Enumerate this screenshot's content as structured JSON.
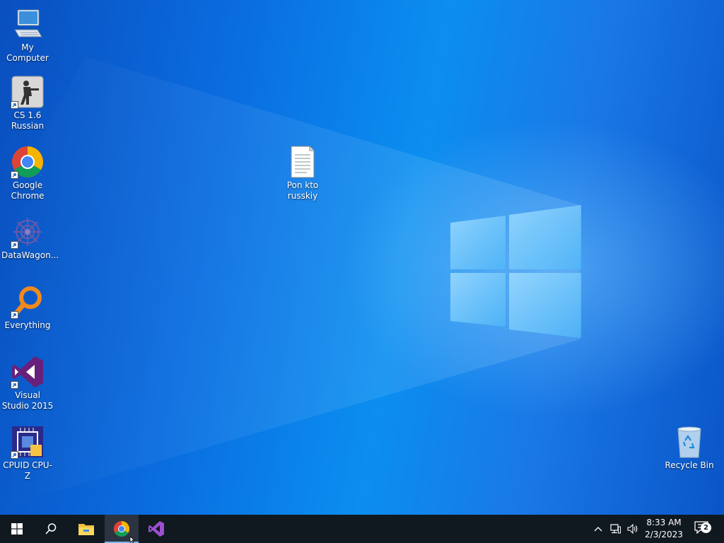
{
  "desktop": {
    "icons": [
      {
        "id": "my-computer",
        "label": "My Computer",
        "shortcut": false
      },
      {
        "id": "cs16",
        "label": "CS 1.6 Russian",
        "shortcut": true
      },
      {
        "id": "chrome",
        "label": "Google Chrome",
        "shortcut": true
      },
      {
        "id": "datawagon",
        "label": "DataWagon...",
        "shortcut": true
      },
      {
        "id": "everything",
        "label": "Everything",
        "shortcut": true
      },
      {
        "id": "vs2015",
        "label": "Visual Studio 2015",
        "shortcut": true
      },
      {
        "id": "cpuz",
        "label": "CPUID CPU-Z",
        "shortcut": true
      },
      {
        "id": "textfile",
        "label": "Pon kto russkiy",
        "shortcut": false
      },
      {
        "id": "recycle",
        "label": "Recycle Bin",
        "shortcut": false
      }
    ]
  },
  "taskbar": {
    "pinned": [
      {
        "name": "start",
        "icon": "windows-logo-icon"
      },
      {
        "name": "search",
        "icon": "search-icon"
      },
      {
        "name": "file-explorer",
        "icon": "folder-icon"
      },
      {
        "name": "chrome",
        "icon": "chrome-icon",
        "active": true
      },
      {
        "name": "visual-studio",
        "icon": "visual-studio-icon"
      }
    ],
    "tray": {
      "time": "8:33 AM",
      "date": "2/3/2023",
      "notification_count": "2"
    }
  },
  "colors": {
    "taskbar": "#101820",
    "accent": "#76b9ed",
    "wallpaper": "#0a6fd8"
  }
}
